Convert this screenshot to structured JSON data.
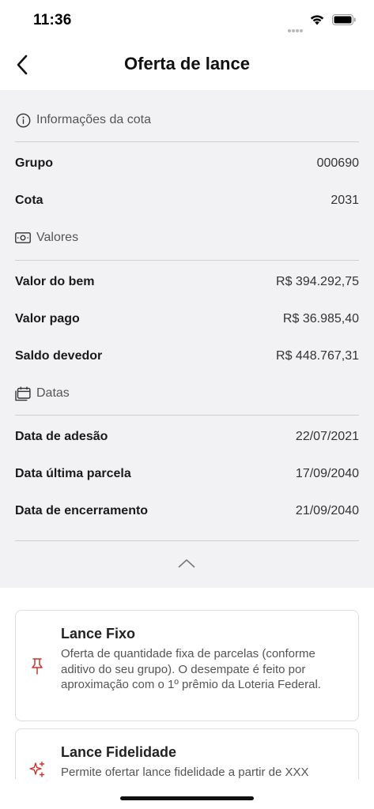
{
  "status": {
    "time": "11:36"
  },
  "header": {
    "title": "Oferta de lance"
  },
  "sections": {
    "cota": {
      "label": "Informações da cota",
      "rows": [
        {
          "label": "Grupo",
          "value": "000690"
        },
        {
          "label": "Cota",
          "value": "2031"
        }
      ]
    },
    "valores": {
      "label": "Valores",
      "rows": [
        {
          "label": "Valor do bem",
          "value": "R$ 394.292,75"
        },
        {
          "label": "Valor pago",
          "value": "R$ 36.985,40"
        },
        {
          "label": "Saldo devedor",
          "value": "R$ 448.767,31"
        }
      ]
    },
    "datas": {
      "label": "Datas",
      "rows": [
        {
          "label": "Data de adesão",
          "value": "22/07/2021"
        },
        {
          "label": "Data última parcela",
          "value": "17/09/2040"
        },
        {
          "label": "Data de encerramento",
          "value": "21/09/2040"
        }
      ]
    }
  },
  "options": [
    {
      "title": "Lance Fixo",
      "description": "Oferta de quantidade fixa de parcelas (conforme aditivo do seu grupo). O desempate é feito por aproximação com o 1º prêmio da Loteria Federal.",
      "icon": "pin-icon"
    },
    {
      "title": "Lance Fidelidade",
      "description": "Permite ofertar lance fidelidade a partir de XXX",
      "icon": "sparkles-icon"
    }
  ],
  "colors": {
    "accent": "#c8372d",
    "panel_bg": "#f2f2f4",
    "divider": "#cfcfd3"
  }
}
